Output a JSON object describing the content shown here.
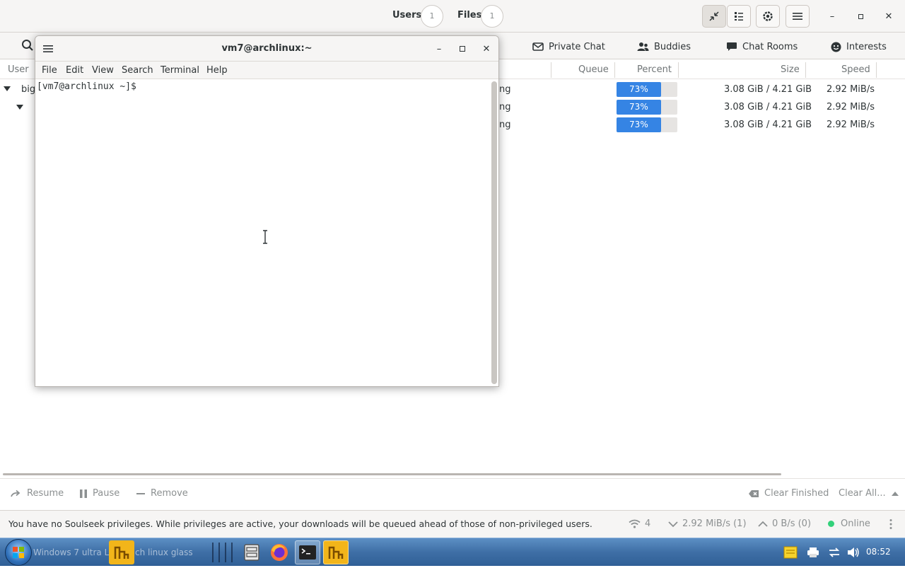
{
  "header": {
    "users_label": "Users",
    "users_count": "1",
    "files_label": "Files",
    "files_count": "1"
  },
  "tabs": [
    {
      "label": "Private Chat",
      "icon": "envelope-icon"
    },
    {
      "label": "Buddies",
      "icon": "buddies-icon"
    },
    {
      "label": "Chat Rooms",
      "icon": "chat-bubble-icon"
    },
    {
      "label": "Interests",
      "icon": "smiley-icon"
    }
  ],
  "columns": {
    "user": "User",
    "queue": "Queue",
    "percent": "Percent",
    "size": "Size",
    "speed": "Speed"
  },
  "tree": {
    "root_label": "big"
  },
  "downloads": [
    {
      "status": "ng",
      "percent": 73,
      "percent_label": "73%",
      "size": "3.08 GiB / 4.21 GiB",
      "speed": "2.92 MiB/s"
    },
    {
      "status": "ng",
      "percent": 73,
      "percent_label": "73%",
      "size": "3.08 GiB / 4.21 GiB",
      "speed": "2.92 MiB/s"
    },
    {
      "status": "ng",
      "percent": 73,
      "percent_label": "73%",
      "size": "3.08 GiB / 4.21 GiB",
      "speed": "2.92 MiB/s"
    }
  ],
  "actions": {
    "resume": "Resume",
    "pause": "Pause",
    "remove": "Remove",
    "clear_finished": "Clear Finished",
    "clear_all": "Clear All..."
  },
  "status": {
    "message": "You have no Soulseek privileges. While privileges are active, your downloads will be queued ahead of those of non-privileged users.",
    "connections": "4",
    "download_speed": "2.92 MiB/s (1)",
    "upload_speed": "0 B/s (0)",
    "online": "Online",
    "online_color": "#33d17a"
  },
  "terminal": {
    "title": "vm7@archlinux:~",
    "menu": [
      "File",
      "Edit",
      "View",
      "Search",
      "Terminal",
      "Help"
    ],
    "prompt": "[vm7@archlinux ~]$"
  },
  "taskbar": {
    "window_title": "Windows 7 ultra L",
    "window_title_2": "ch linux glass",
    "clock": "08:52"
  },
  "colors": {
    "accent": "#3584e4",
    "taskbar": "#3f6fa6"
  }
}
